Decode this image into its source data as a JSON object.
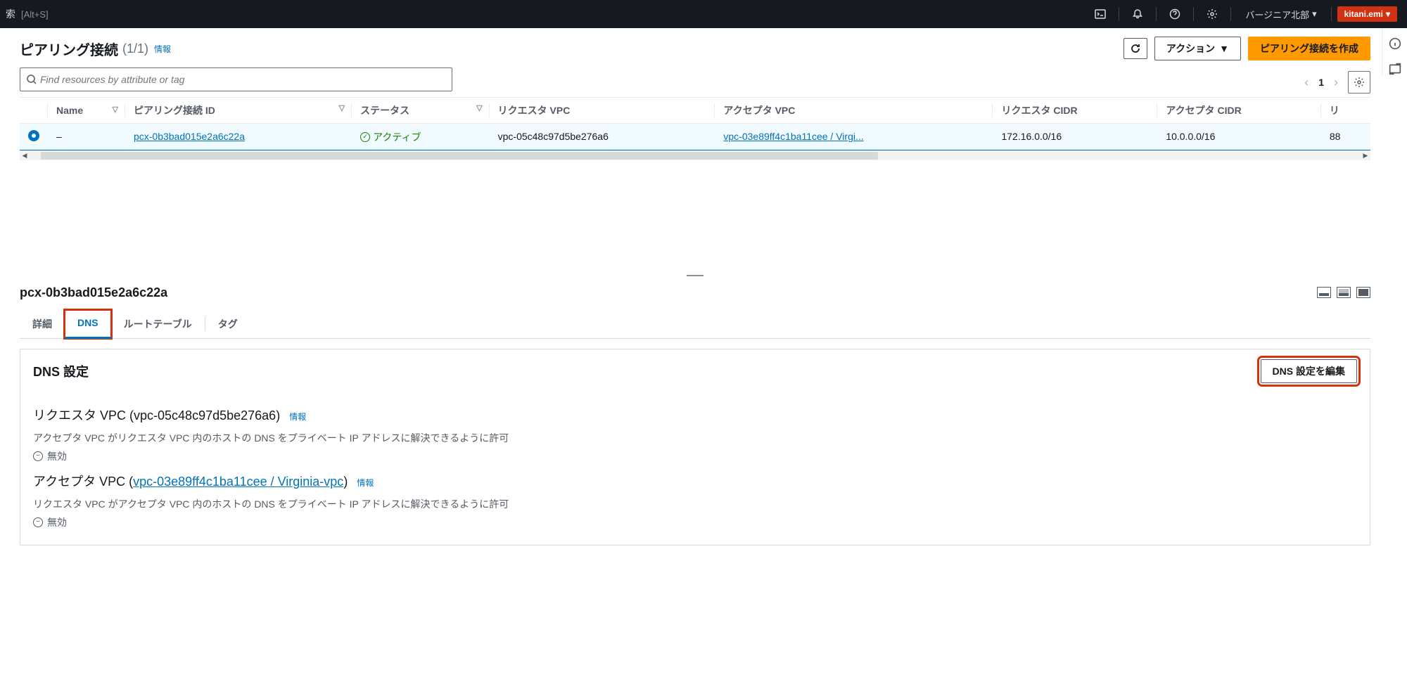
{
  "nav": {
    "search_char": "索",
    "shortcut": "[Alt+S]",
    "region": "バージニア北部",
    "user": "kitani.emi"
  },
  "page": {
    "title": "ピアリング接続",
    "count": "(1/1)",
    "info": "情報",
    "refresh_aria": "更新",
    "actions_label": "アクション",
    "create_label": "ピアリング接続を作成",
    "search_placeholder": "Find resources by attribute or tag",
    "page_num": "1"
  },
  "table": {
    "headers": {
      "name": "Name",
      "peer_id": "ピアリング接続 ID",
      "status": "ステータス",
      "requester_vpc": "リクエスタ VPC",
      "accepter_vpc": "アクセプタ VPC",
      "requester_cidr": "リクエスタ CIDR",
      "accepter_cidr": "アクセプタ CIDR",
      "last_col": "リ"
    },
    "row": {
      "name": "–",
      "peer_id": "pcx-0b3bad015e2a6c22a",
      "status": "アクティブ",
      "requester_vpc": "vpc-05c48c97d5be276a6",
      "accepter_vpc": "vpc-03e89ff4c1ba11cee / Virgi...",
      "requester_cidr": "172.16.0.0/16",
      "accepter_cidr": "10.0.0.0/16",
      "last_val": "88"
    }
  },
  "detail": {
    "id": "pcx-0b3bad015e2a6c22a",
    "tabs": {
      "details": "詳細",
      "dns": "DNS",
      "route": "ルートテーブル",
      "tags": "タグ"
    },
    "dns_panel": {
      "title": "DNS 設定",
      "edit_label": "DNS 設定を編集",
      "requester_heading_prefix": "リクエスタ VPC (",
      "requester_vpc_id": "vpc-05c48c97d5be276a6",
      "requester_heading_suffix": ")",
      "info": "情報",
      "requester_desc": "アクセプタ VPC がリクエスタ VPC 内のホストの DNS をプライベート IP アドレスに解決できるように許可",
      "disabled": "無効",
      "accepter_heading_prefix": "アクセプタ VPC (",
      "accepter_vpc_link": "vpc-03e89ff4c1ba11cee / Virginia-vpc",
      "accepter_heading_suffix": ")",
      "accepter_desc": "リクエスタ VPC がアクセプタ VPC 内のホストの DNS をプライベート IP アドレスに解決できるように許可"
    }
  }
}
